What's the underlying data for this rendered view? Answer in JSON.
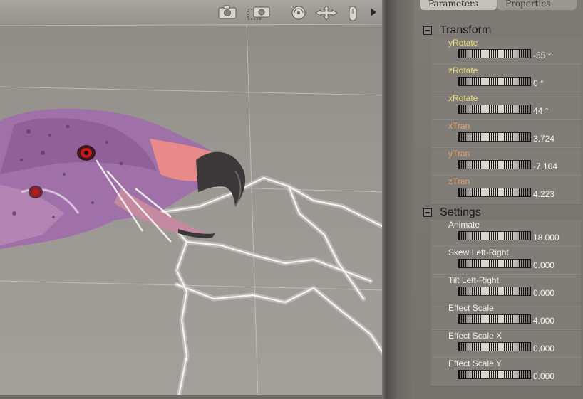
{
  "tabs": [
    {
      "label": "Parameters",
      "active": true
    },
    {
      "label": "Properties",
      "active": false
    }
  ],
  "sections": [
    {
      "title": "Transform",
      "params": [
        {
          "label": "yRotate",
          "value": "-55 °",
          "label_color": "yellow"
        },
        {
          "label": "zRotate",
          "value": "0 °",
          "label_color": "yellow"
        },
        {
          "label": "xRotate",
          "value": "44 °",
          "label_color": "yellow"
        },
        {
          "label": "xTran",
          "value": "3.724",
          "label_color": "orange"
        },
        {
          "label": "yTran",
          "value": "-7.104",
          "label_color": "orange"
        },
        {
          "label": "zTran",
          "value": "4.223",
          "label_color": "orange"
        }
      ]
    },
    {
      "title": "Settings",
      "params": [
        {
          "label": "Animate",
          "value": "18.000",
          "label_color": "white"
        },
        {
          "label": "Skew Left-Right",
          "value": "0.000",
          "label_color": "white"
        },
        {
          "label": "Tilt Left-Right",
          "value": "0.000",
          "label_color": "white"
        },
        {
          "label": "Effect Scale",
          "value": "4.000",
          "label_color": "white"
        },
        {
          "label": "Effect Scale X",
          "value": "0.000",
          "label_color": "white"
        },
        {
          "label": "Effect Scale Y",
          "value": "0.000",
          "label_color": "white"
        }
      ]
    }
  ],
  "toolbar_icons": [
    "camera-icon",
    "camera-select-icon",
    "rotate-trackball-icon",
    "translate-cross-icon",
    "hand-grab-icon",
    "play-arrow-icon"
  ],
  "colors": {
    "label_yellow": "#e8df7a",
    "label_orange": "#e6a265",
    "label_white": "#f1efe9",
    "panel": "#7e7a75",
    "viewport": "#9a9691"
  }
}
